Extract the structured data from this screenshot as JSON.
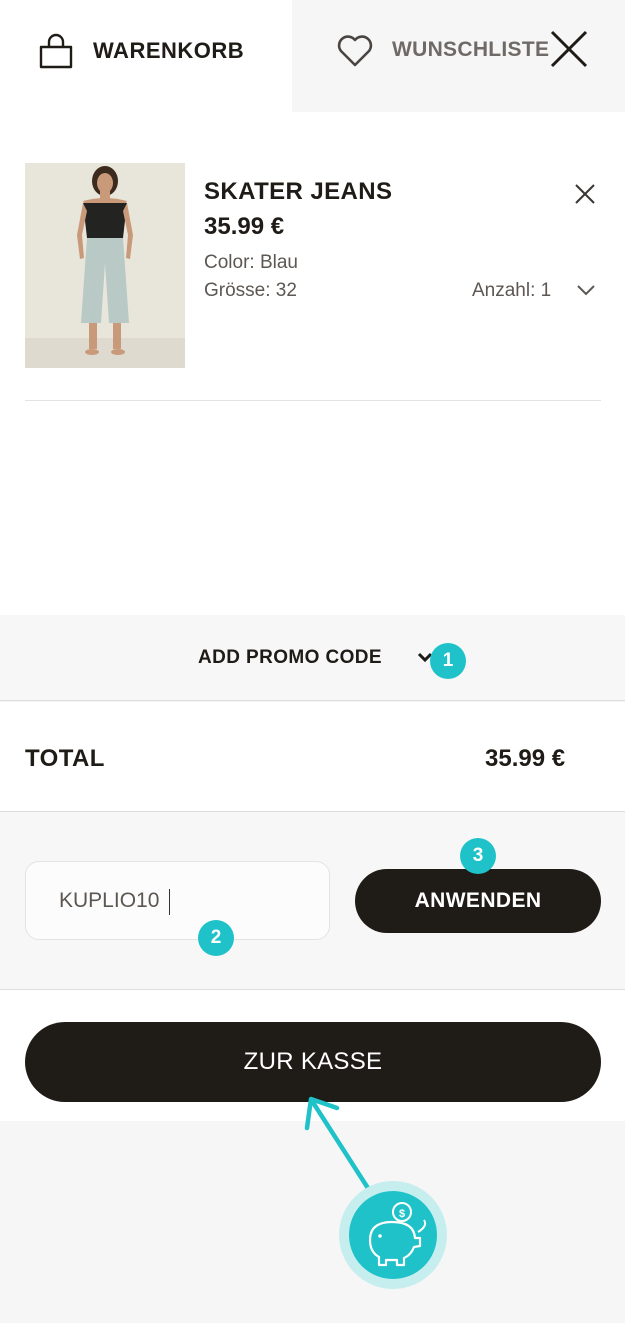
{
  "tabs": {
    "cart_label": "WARENKORB",
    "wishlist_label": "WUNSCHLISTE"
  },
  "item": {
    "name": "SKATER JEANS",
    "price": "35.99 €",
    "color": "Color: Blau",
    "size": "Grösse: 32",
    "quantity": "Anzahl: 1"
  },
  "promo": {
    "toggle_label": "ADD PROMO CODE",
    "input_value": "KUPLIO10",
    "apply_label": "ANWENDEN"
  },
  "total": {
    "label": "TOTAL",
    "value": "35.99 €"
  },
  "checkout": {
    "label": "ZUR KASSE"
  },
  "annotations": {
    "step1": "1",
    "step2": "2",
    "step3": "3"
  },
  "colors": {
    "dark": "#1f1b16",
    "accent": "#1ec2c8",
    "muted_text": "#5c5753"
  },
  "icons": [
    "bag-icon",
    "heart-icon",
    "close-icon",
    "chevron-down-icon",
    "piggy-bank-icon"
  ]
}
